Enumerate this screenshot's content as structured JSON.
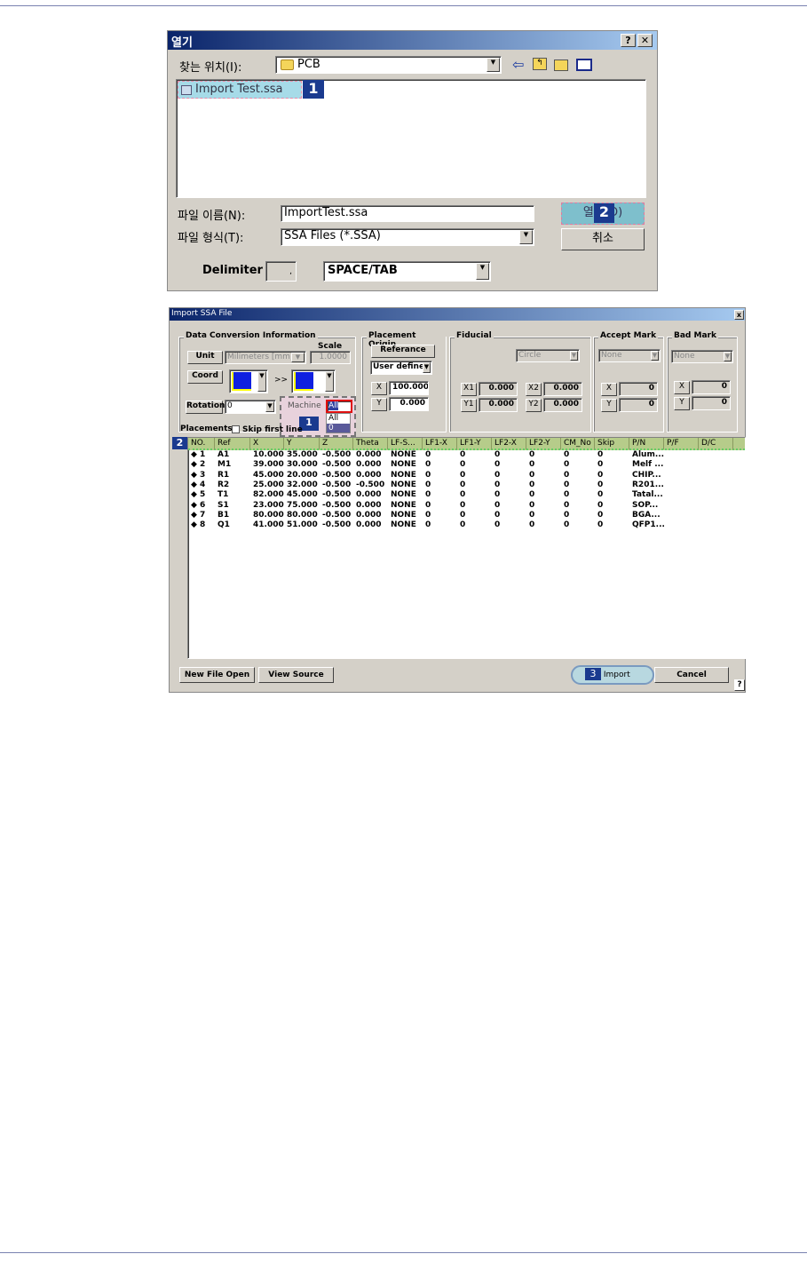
{
  "open_dialog": {
    "title": "열기",
    "help": "?",
    "close": "✕",
    "look_in_label": "찾는 위치(I):",
    "look_in_value": "PCB",
    "files": [
      "Import Test.ssa"
    ],
    "filename_label": "파일 이름(N):",
    "filename_value": "ImportTest.ssa",
    "filetype_label": "파일 형식(T):",
    "filetype_value": "SSA Files (*.SSA)",
    "open_button": "열기(O)",
    "cancel_button": "취소",
    "delimiter_label": "Delimiter",
    "delimiter_value": ",",
    "delimiter_select": "SPACE/TAB",
    "badge1": "1",
    "badge2": "2"
  },
  "import_dialog": {
    "title": "Import SSA File",
    "close": "x",
    "dci": {
      "title": "Data Conversion Information",
      "scale_label": "Scale",
      "unit_label": "Unit",
      "unit_value": "Milimeters [mm]",
      "scale_value": "1.0000",
      "coord_label": "Coord",
      "arrow": ">>",
      "rotation_label": "Rotation",
      "rotation_value": "0",
      "machine_label": "Machine",
      "machine_value": "All",
      "machine_options": [
        "All",
        "0"
      ],
      "badge": "1"
    },
    "origin": {
      "title": "Placement Origin",
      "reference": "Referance",
      "mode": "User defined",
      "x_label": "X",
      "x_value": "100.000",
      "y_label": "Y",
      "y_value": "0.000"
    },
    "fiducial": {
      "title": "Fiducial",
      "shape": "Circle",
      "x1_label": "X1",
      "x1": "0.000",
      "x2_label": "X2",
      "x2": "0.000",
      "y1_label": "Y1",
      "y1": "0.000",
      "y2_label": "Y2",
      "y2": "0.000"
    },
    "accept": {
      "title": "Accept Mark",
      "mode": "None",
      "x_label": "X",
      "x": "0",
      "y_label": "Y",
      "y": "0"
    },
    "bad": {
      "title": "Bad Mark",
      "mode": "None",
      "x_label": "X",
      "x": "0",
      "y_label": "Y",
      "y": "0"
    },
    "placements_label": "Placements",
    "skip_first_line": "Skip first line",
    "table_badge": "2",
    "columns": [
      "NO.",
      "Ref",
      "X",
      "Y",
      "Z",
      "Theta",
      "LF-S...",
      "LF1-X",
      "LF1-Y",
      "LF2-X",
      "LF2-Y",
      "CM_No",
      "Skip",
      "P/N",
      "P/F",
      "D/C"
    ],
    "rows": [
      [
        "◆ 1",
        "A1",
        "10.000",
        "35.000",
        "-0.500",
        "0.000",
        "NONE",
        "0",
        "0",
        "0",
        "0",
        "0",
        "0",
        "Alum..."
      ],
      [
        "◆ 2",
        "M1",
        "39.000",
        "30.000",
        "-0.500",
        "0.000",
        "NONE",
        "0",
        "0",
        "0",
        "0",
        "0",
        "0",
        "Melf ..."
      ],
      [
        "◆ 3",
        "R1",
        "45.000",
        "20.000",
        "-0.500",
        "0.000",
        "NONE",
        "0",
        "0",
        "0",
        "0",
        "0",
        "0",
        "CHIP..."
      ],
      [
        "◆ 4",
        "R2",
        "25.000",
        "32.000",
        "-0.500",
        "-0.500",
        "NONE",
        "0",
        "0",
        "0",
        "0",
        "0",
        "0",
        "R201..."
      ],
      [
        "◆ 5",
        "T1",
        "82.000",
        "45.000",
        "-0.500",
        "0.000",
        "NONE",
        "0",
        "0",
        "0",
        "0",
        "0",
        "0",
        "Tatal..."
      ],
      [
        "◆ 6",
        "S1",
        "23.000",
        "75.000",
        "-0.500",
        "0.000",
        "NONE",
        "0",
        "0",
        "0",
        "0",
        "0",
        "0",
        "SOP..."
      ],
      [
        "◆ 7",
        "B1",
        "80.000",
        "80.000",
        "-0.500",
        "0.000",
        "NONE",
        "0",
        "0",
        "0",
        "0",
        "0",
        "0",
        "BGA..."
      ],
      [
        "◆ 8",
        "Q1",
        "41.000",
        "51.000",
        "-0.500",
        "0.000",
        "NONE",
        "0",
        "0",
        "0",
        "0",
        "0",
        "0",
        "QFP1..."
      ]
    ],
    "new_file_open": "New File Open",
    "view_source": "View Source",
    "import_button": "Import",
    "import_badge": "3",
    "cancel_button": "Cancel",
    "help": "?"
  }
}
